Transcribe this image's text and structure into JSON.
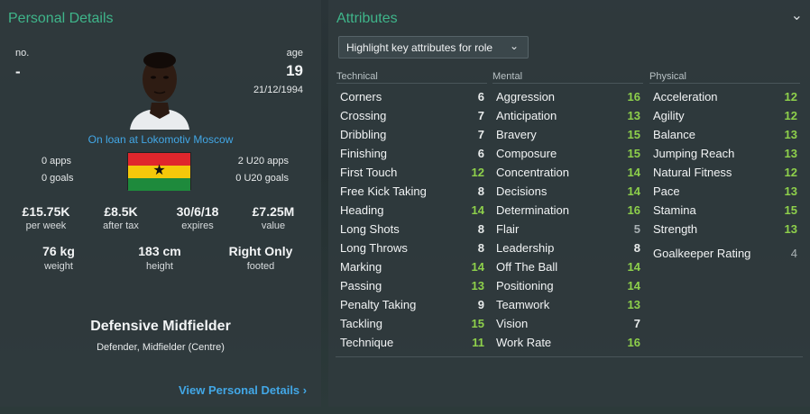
{
  "personal": {
    "title": "Personal Details",
    "no_label": "no.",
    "no_value": "-",
    "age_label": "age",
    "age_value": "19",
    "dob": "21/12/1994",
    "loan_text": "On loan at Lokomotiv Moscow",
    "apps": "0 apps",
    "goals": "0 goals",
    "u20_apps": "2 U20 apps",
    "u20_goals": "0 U20 goals",
    "stats": [
      {
        "value": "£15.75K",
        "label": "per week"
      },
      {
        "value": "£8.5K",
        "label": "after tax"
      },
      {
        "value": "30/6/18",
        "label": "expires"
      },
      {
        "value": "£7.25M",
        "label": "value"
      }
    ],
    "physical": [
      {
        "value": "76 kg",
        "label": "weight"
      },
      {
        "value": "183 cm",
        "label": "height"
      },
      {
        "value": "Right Only",
        "label": "footed"
      }
    ],
    "position_main": "Defensive Midfielder",
    "position_sub": "Defender, Midfielder (Centre)",
    "view_link": "View Personal Details",
    "flag_colors": [
      "#e0262c",
      "#f5c80a",
      "#1e8a3c"
    ]
  },
  "attributes": {
    "title": "Attributes",
    "dropdown_label": "Highlight key attributes for role",
    "technical": {
      "header": "Technical",
      "items": [
        {
          "name": "Corners",
          "value": "6",
          "tone": "mid"
        },
        {
          "name": "Crossing",
          "value": "7",
          "tone": "mid"
        },
        {
          "name": "Dribbling",
          "value": "7",
          "tone": "mid"
        },
        {
          "name": "Finishing",
          "value": "6",
          "tone": "mid"
        },
        {
          "name": "First Touch",
          "value": "12",
          "tone": "high"
        },
        {
          "name": "Free Kick Taking",
          "value": "8",
          "tone": "mid"
        },
        {
          "name": "Heading",
          "value": "14",
          "tone": "high"
        },
        {
          "name": "Long Shots",
          "value": "8",
          "tone": "mid"
        },
        {
          "name": "Long Throws",
          "value": "8",
          "tone": "mid"
        },
        {
          "name": "Marking",
          "value": "14",
          "tone": "high"
        },
        {
          "name": "Passing",
          "value": "13",
          "tone": "high"
        },
        {
          "name": "Penalty Taking",
          "value": "9",
          "tone": "mid"
        },
        {
          "name": "Tackling",
          "value": "15",
          "tone": "high"
        },
        {
          "name": "Technique",
          "value": "11",
          "tone": "high"
        }
      ]
    },
    "mental": {
      "header": "Mental",
      "items": [
        {
          "name": "Aggression",
          "value": "16",
          "tone": "high"
        },
        {
          "name": "Anticipation",
          "value": "13",
          "tone": "high"
        },
        {
          "name": "Bravery",
          "value": "15",
          "tone": "high"
        },
        {
          "name": "Composure",
          "value": "15",
          "tone": "high"
        },
        {
          "name": "Concentration",
          "value": "14",
          "tone": "high"
        },
        {
          "name": "Decisions",
          "value": "14",
          "tone": "high"
        },
        {
          "name": "Determination",
          "value": "16",
          "tone": "high"
        },
        {
          "name": "Flair",
          "value": "5",
          "tone": "low"
        },
        {
          "name": "Leadership",
          "value": "8",
          "tone": "mid"
        },
        {
          "name": "Off The Ball",
          "value": "14",
          "tone": "high"
        },
        {
          "name": "Positioning",
          "value": "14",
          "tone": "high"
        },
        {
          "name": "Teamwork",
          "value": "13",
          "tone": "high"
        },
        {
          "name": "Vision",
          "value": "7",
          "tone": "mid"
        },
        {
          "name": "Work Rate",
          "value": "16",
          "tone": "high"
        }
      ]
    },
    "physical": {
      "header": "Physical",
      "items": [
        {
          "name": "Acceleration",
          "value": "12",
          "tone": "high"
        },
        {
          "name": "Agility",
          "value": "12",
          "tone": "high"
        },
        {
          "name": "Balance",
          "value": "13",
          "tone": "high"
        },
        {
          "name": "Jumping Reach",
          "value": "13",
          "tone": "high"
        },
        {
          "name": "Natural Fitness",
          "value": "12",
          "tone": "high"
        },
        {
          "name": "Pace",
          "value": "13",
          "tone": "high"
        },
        {
          "name": "Stamina",
          "value": "15",
          "tone": "high"
        },
        {
          "name": "Strength",
          "value": "13",
          "tone": "high"
        }
      ],
      "gk_label": "Goalkeeper Rating",
      "gk_value": "4"
    }
  }
}
